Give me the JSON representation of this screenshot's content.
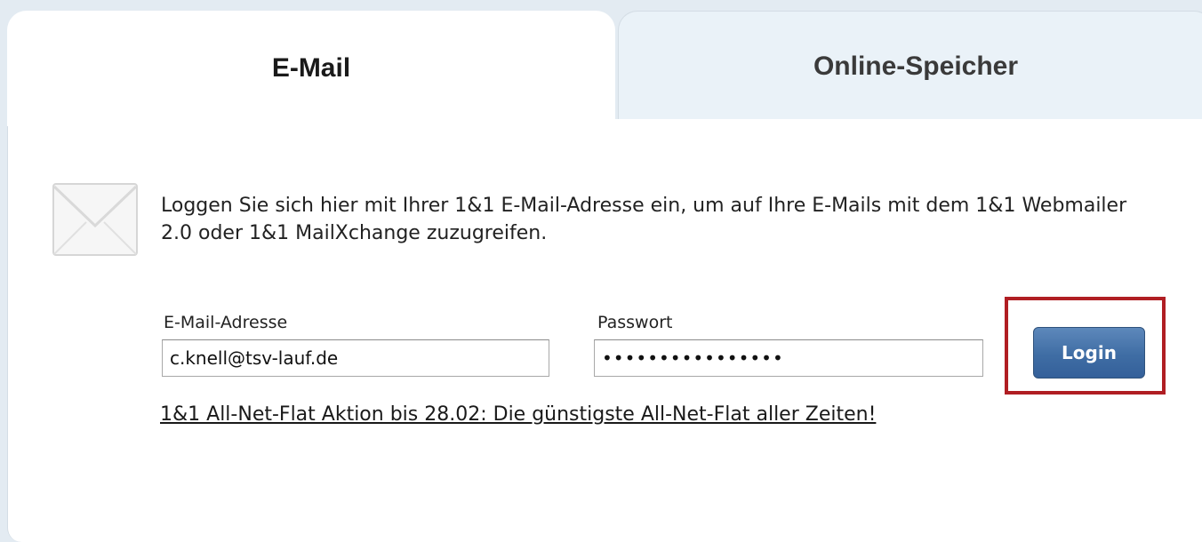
{
  "tabs": {
    "email_label": "E-Mail",
    "storage_label": "Online-Speicher"
  },
  "login": {
    "icon": "envelope-icon",
    "description": "Loggen Sie sich hier mit Ihrer 1&1 E-Mail-Adresse ein, um auf Ihre E-Mails mit dem 1&1 Webmailer 2.0 oder 1&1 MailXchange zuzugreifen.",
    "email_label": "E-Mail-Adresse",
    "email_value": "c.knell@tsv-lauf.de",
    "password_label": "Passwort",
    "password_value": "••••••••••••••••",
    "button_label": "Login",
    "highlight_color": "#b01e23"
  },
  "promo": {
    "link_text": "1&1 All-Net-Flat Aktion bis 28.02: Die günstigste All-Net-Flat aller Zeiten!"
  }
}
